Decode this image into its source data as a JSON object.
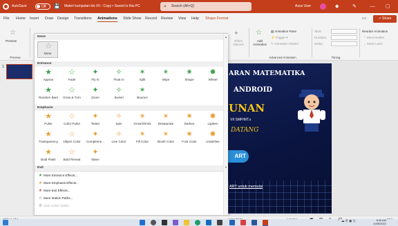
{
  "titlebar": {
    "autosave_label": "AutoSave",
    "autosave_state": "Off",
    "doc_title": "Materi kumpulan kls VII - Copy • Saved to this PC",
    "search_placeholder": "Search (Alt+Q)",
    "user_name": "Asus User",
    "minimize": "—",
    "maximize": "▢",
    "save_icon": "save-icon",
    "undo_icon": "undo-icon"
  },
  "ribbon_tabs": [
    "File",
    "Home",
    "Insert",
    "Draw",
    "Design",
    "Transitions",
    "Animations",
    "Slide Show",
    "Record",
    "Review",
    "View",
    "Help",
    "Shape Format"
  ],
  "active_tab": "Animations",
  "share_label": "Share",
  "comment_icon": "comment-icon",
  "ribbon": {
    "preview_label": "Preview",
    "preview_group": "Preview",
    "effect_options": "Effect Options",
    "add_animation": "Add Animation",
    "animation_pane": "Animation Pane",
    "trigger": "Trigger",
    "animation_painter": "Animation Painter",
    "advanced_group": "Advanced Animation",
    "start": "Start:",
    "duration": "Duration:",
    "delay": "Delay:",
    "timing_group": "Timing",
    "reorder": "Reorder Animation",
    "move_earlier": "Move Earlier",
    "move_later": "Move Later"
  },
  "gallery": {
    "none_header": "None",
    "none_item": "None",
    "entrance_header": "Entrance",
    "entrance": [
      "Appear",
      "Fade",
      "Fly In",
      "Float In",
      "Split",
      "Wipe",
      "Shape",
      "Wheel",
      "Random Bars",
      "Grow & Turn",
      "Zoom",
      "Swivel",
      "Bounce"
    ],
    "emphasis_header": "Emphasis",
    "emphasis": [
      "Pulse",
      "Color Pulse",
      "Teeter",
      "Spin",
      "Grow/Shrink",
      "Desaturate",
      "Darken",
      "Lighten",
      "Transparency",
      "Object Color",
      "Compleme...",
      "Line Color",
      "Fill Color",
      "Brush Color",
      "Font Color",
      "Underline",
      "Bold Flash",
      "Bold Reveal",
      "Wave"
    ],
    "exit_header": "Exit",
    "more": [
      "More Entrance Effects...",
      "More Emphasis Effects...",
      "More Exit Effects...",
      "More Motion Paths...",
      "OLE Action Verbs..."
    ],
    "colors": {
      "entrance": "#3fa34d",
      "emphasis": "#e8a23a",
      "exit": "#d9534f",
      "accent": "#c43e1c"
    }
  },
  "slide": {
    "number": "1",
    "line1": "ARAN MATEMATIKA",
    "line2": "ANDROID",
    "line3": "UNAN",
    "line4": "VII SMP/MT.s",
    "line5": "DATANG",
    "button": "ART",
    "footer": "ART untuk memulai"
  },
  "status": {
    "slide_count": "Slide 1 of 1",
    "accessibility": "ssing fonts...",
    "notes": "Notes",
    "zoom": "91%"
  },
  "taskbar": {
    "time": "8:40 AM",
    "date": "11/08/2022"
  }
}
